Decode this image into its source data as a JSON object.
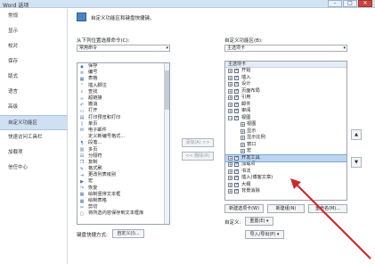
{
  "window": {
    "title": "Word 选项",
    "minimize": "–",
    "maximize": "□",
    "close": "✕"
  },
  "nav": {
    "items": [
      "常规",
      "显示",
      "校对",
      "保存",
      "版式",
      "语言",
      "高级",
      "自定义功能区",
      "快速访问工具栏",
      "加载项",
      "信任中心"
    ],
    "active_index": 7
  },
  "customize_description": "自定义功能区和键盘快捷键。",
  "left": {
    "label": "从下列位置选择命令(C):",
    "dropdown": "常用命令",
    "commands": [
      {
        "icon": "save-icon",
        "label": "保存"
      },
      {
        "icon": "numbering-icon",
        "label": "编号"
      },
      {
        "icon": "table-icon",
        "label": "表格"
      },
      {
        "icon": "footnote-icon",
        "label": "插入脚注"
      },
      {
        "icon": "find-icon",
        "label": "查找"
      },
      {
        "icon": "hyperlink-icon",
        "label": "超链接"
      },
      {
        "icon": "undo-icon",
        "label": "撤消"
      },
      {
        "icon": "open-icon",
        "label": "打开"
      },
      {
        "icon": "print-preview-icon",
        "label": "打印预览和打印"
      },
      {
        "icon": "single-page-icon",
        "label": "单页"
      },
      {
        "icon": "email-icon",
        "label": "电子邮件"
      },
      {
        "icon": "new-style-icon",
        "label": "定义新编号格式..."
      },
      {
        "icon": "paragraph-icon",
        "label": "段落..."
      },
      {
        "icon": "multi-page-icon",
        "label": "多页"
      },
      {
        "icon": "separator-icon",
        "label": "分隔符"
      },
      {
        "icon": "copy-icon",
        "label": "复制"
      },
      {
        "icon": "format-painter-icon",
        "label": "格式刷"
      },
      {
        "icon": "change-list-level-icon",
        "label": "更改列表级别"
      },
      {
        "icon": "macro-icon",
        "label": "宏"
      },
      {
        "icon": "redo-icon",
        "label": "恢复"
      },
      {
        "icon": "draw-table-icon",
        "label": "绘制竖排文本框"
      },
      {
        "icon": "draw-table-icon",
        "label": "绘制表格"
      },
      {
        "icon": "cut-icon",
        "label": "剪切"
      },
      {
        "icon": "textbox-icon",
        "label": "将所选内容保存到文本框库"
      }
    ]
  },
  "middle": {
    "add": "添加(A) >>",
    "remove": "<< 删除(R)"
  },
  "right": {
    "label": "自定义功能区(B):",
    "dropdown": "主选项卡",
    "header": "主选项卡",
    "tabs": [
      {
        "label": "开始",
        "checked": true,
        "expander": "+",
        "child": false
      },
      {
        "label": "插入",
        "checked": true,
        "expander": "+",
        "child": false
      },
      {
        "label": "设计",
        "checked": true,
        "expander": "+",
        "child": false
      },
      {
        "label": "页面布局",
        "checked": true,
        "expander": "+",
        "child": false
      },
      {
        "label": "引用",
        "checked": true,
        "expander": "+",
        "child": false
      },
      {
        "label": "邮件",
        "checked": true,
        "expander": "+",
        "child": false
      },
      {
        "label": "审阅",
        "checked": true,
        "expander": "+",
        "child": false
      },
      {
        "label": "视图",
        "checked": true,
        "expander": "−",
        "child": false
      },
      {
        "label": "视图",
        "checked": false,
        "expander": "+",
        "child": true
      },
      {
        "label": "显示",
        "checked": false,
        "expander": "+",
        "child": true
      },
      {
        "label": "显示比例",
        "checked": false,
        "expander": "+",
        "child": true
      },
      {
        "label": "窗口",
        "checked": false,
        "expander": "+",
        "child": true
      },
      {
        "label": "宏",
        "checked": false,
        "expander": "+",
        "child": true
      },
      {
        "label": "开发工具",
        "checked": true,
        "expander": "+",
        "child": false,
        "highlight": true
      },
      {
        "label": "加载项",
        "checked": true,
        "expander": "+",
        "child": false
      },
      {
        "label": "书法",
        "checked": true,
        "expander": "+",
        "child": false
      },
      {
        "label": "插入(博客文章)",
        "checked": true,
        "expander": "+",
        "child": false
      },
      {
        "label": "大纲",
        "checked": true,
        "expander": "+",
        "child": false
      },
      {
        "label": "背景消除",
        "checked": true,
        "expander": "+",
        "child": false
      }
    ],
    "new_tab": "新建选项卡(W)",
    "new_group": "新建组(N)",
    "rename": "重命名(M)...",
    "customize_label": "自定义:",
    "reset": "重置(E) ▾",
    "import_export": "导入/导出(P) ▾",
    "move_up": "▲",
    "move_down": "▼"
  },
  "keyboard": {
    "label": "键盘快捷方式:",
    "button": "自定义(I)..."
  },
  "accent": "#cc2a2a"
}
